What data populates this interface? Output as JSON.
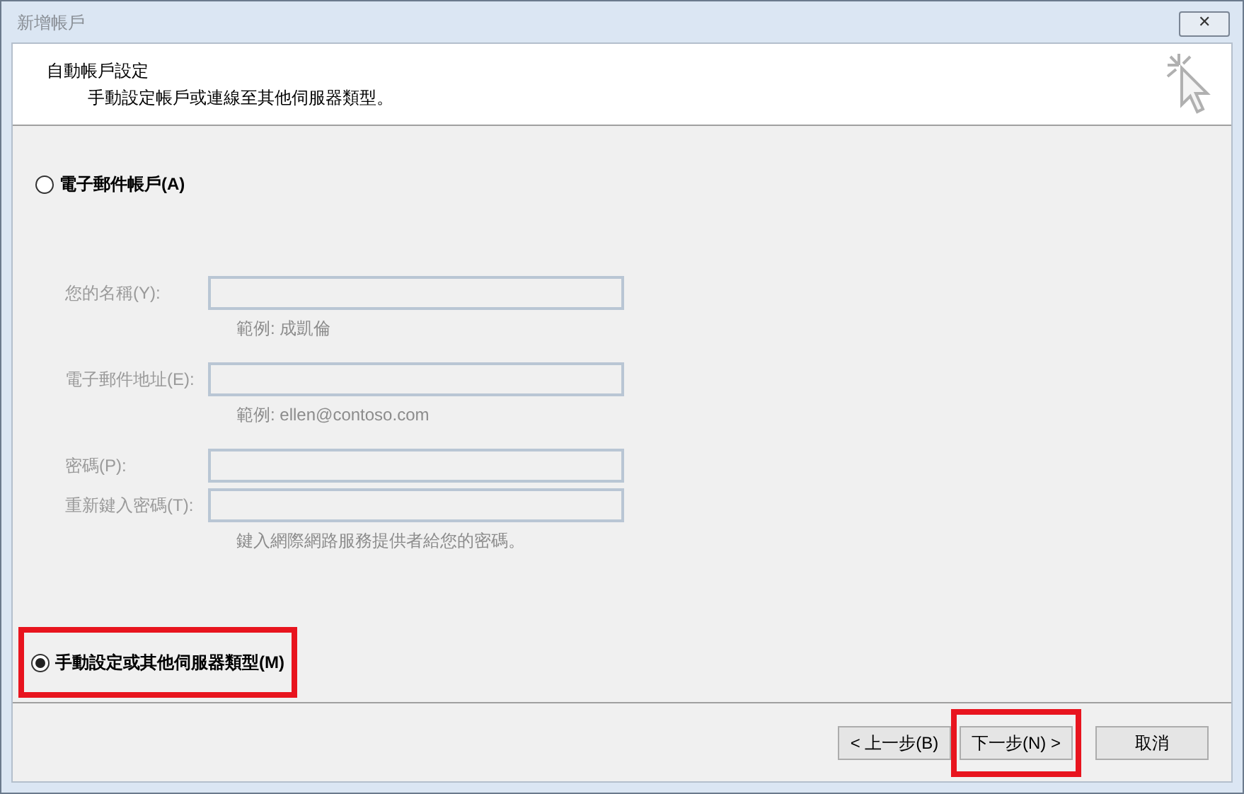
{
  "window": {
    "title": "新增帳戶",
    "close": "✕"
  },
  "header": {
    "title": "自動帳戶設定",
    "subtitle": "手動設定帳戶或連線至其他伺服器類型。"
  },
  "options": [
    {
      "label": "電子郵件帳戶(A)",
      "selected": false,
      "highlighted": false
    },
    {
      "label": "手動設定或其他伺服器類型(M)",
      "selected": true,
      "highlighted": true
    }
  ],
  "fields": [
    {
      "label": "您的名稱(Y):",
      "hint": "範例: 成凱倫",
      "disabled": true
    },
    {
      "label": "電子郵件地址(E):",
      "hint": "範例: ellen@contoso.com",
      "disabled": true
    },
    {
      "label": "密碼(P):",
      "disabled": true
    },
    {
      "label": "重新鍵入密碼(T):",
      "hint": "鍵入網際網路服務提供者給您的密碼。",
      "disabled": true
    }
  ],
  "buttons": [
    {
      "label": "< 上一步(B)",
      "highlighted": false
    },
    {
      "label": "下一步(N) >",
      "highlighted": true
    },
    {
      "label": "取消",
      "highlighted": false
    }
  ]
}
